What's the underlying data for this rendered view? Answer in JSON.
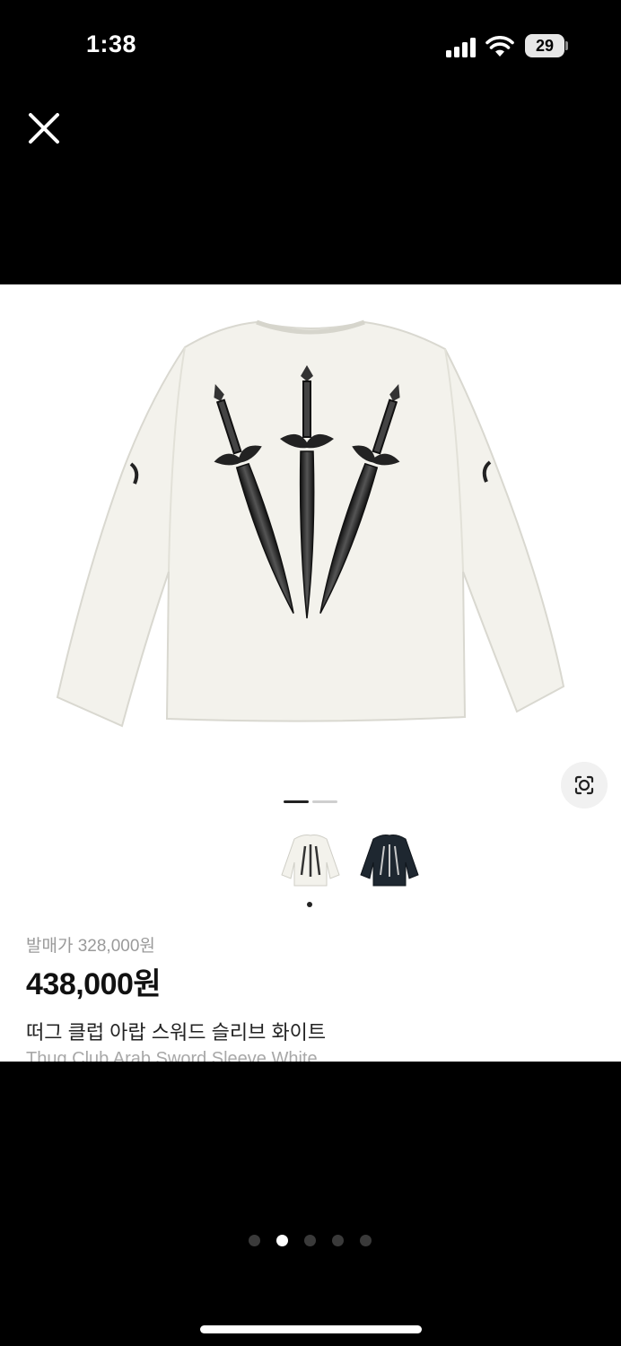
{
  "status_bar": {
    "time": "1:38",
    "battery_level": "29",
    "icons": [
      "cellular-signal-icon",
      "wifi-icon",
      "battery-icon"
    ]
  },
  "toolbar": {
    "close_icon": "close-icon"
  },
  "product": {
    "image_alt_icon": "tshirt-sword-print-image",
    "release_price": "발매가 328,000원",
    "price": "438,000원",
    "name_ko": "떠그 클럽 아랍 스워드 슬리브 화이트",
    "name_en": "Thug Club Arab Sword Sleeve White"
  },
  "image_pager": {
    "current": 1,
    "total": 2
  },
  "thumbnails": {
    "items": [
      "White",
      "Black"
    ],
    "selected_index": 0
  },
  "screenshot_pager": {
    "current": 2,
    "total": 5
  },
  "colors": {
    "background": "#000000",
    "viewer_background": "#ffffff",
    "price_text": "#111111",
    "muted_text": "#9a9a9a",
    "shirt_white": "#f3f2ec",
    "shirt_black": "#1e2730"
  }
}
